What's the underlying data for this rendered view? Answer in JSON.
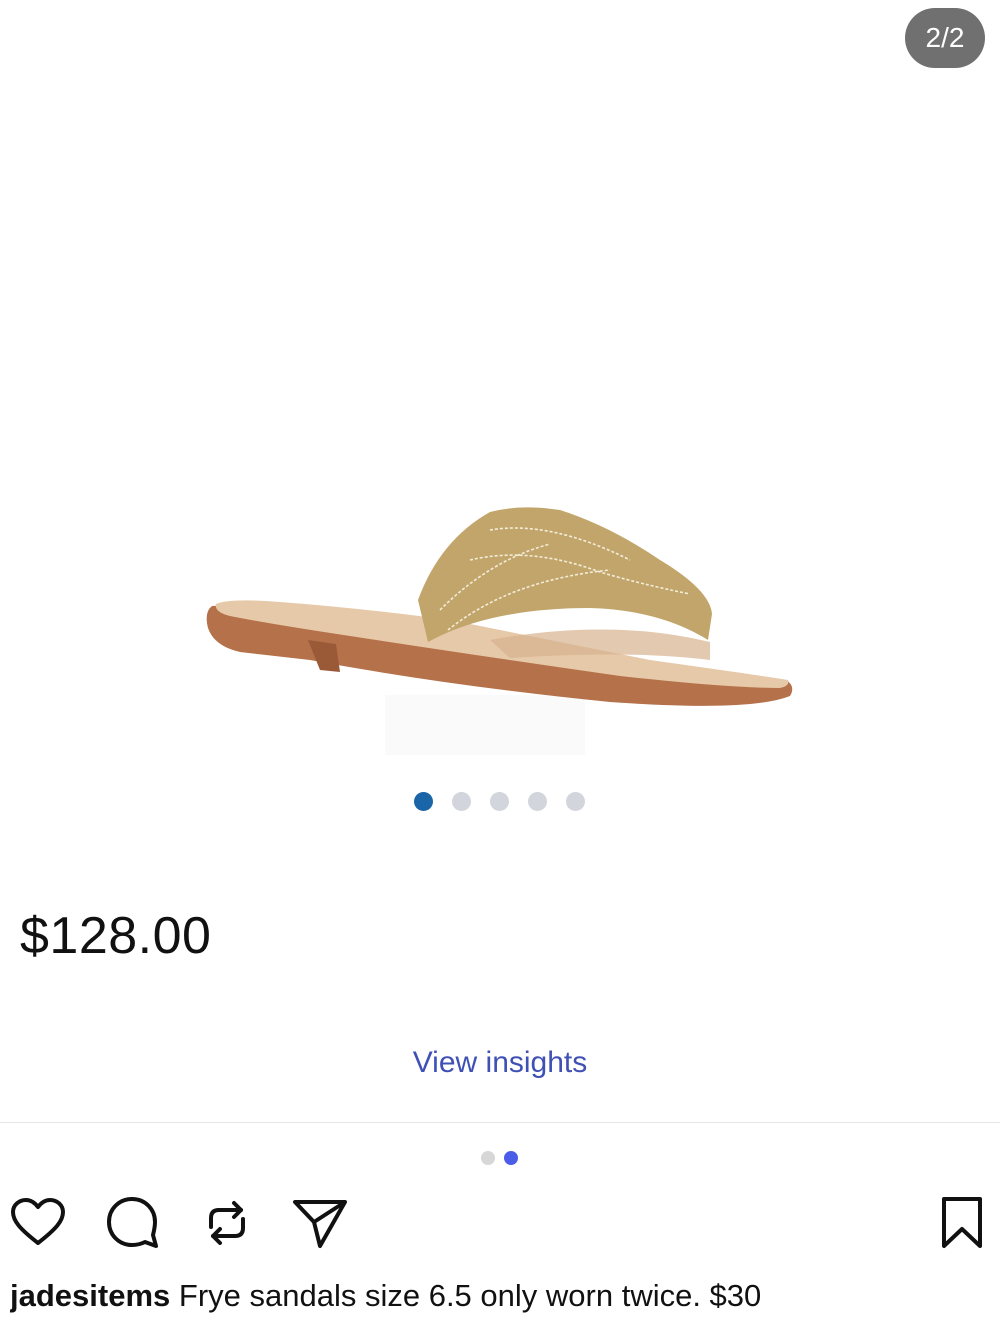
{
  "header": {
    "image_counter": "2/2"
  },
  "product": {
    "image_icon": "sandal-product-image",
    "price": "$128.00",
    "image_dots": {
      "total": 5,
      "active_index": 0
    }
  },
  "insights": {
    "label": "View insights"
  },
  "carousel": {
    "total": 2,
    "active_index": 1
  },
  "actions": {
    "like_icon": "heart-icon",
    "comment_icon": "comment-icon",
    "repost_icon": "repost-icon",
    "share_icon": "send-icon",
    "save_icon": "bookmark-icon"
  },
  "caption": {
    "username": "jadesitems",
    "text": "Frye sandals size 6.5 only worn twice. $30"
  },
  "colors": {
    "link": "#3f51b5",
    "product_dot_active": "#1a64a8",
    "carousel_dot_active": "#4b5de8",
    "badge_bg": "#707070"
  }
}
